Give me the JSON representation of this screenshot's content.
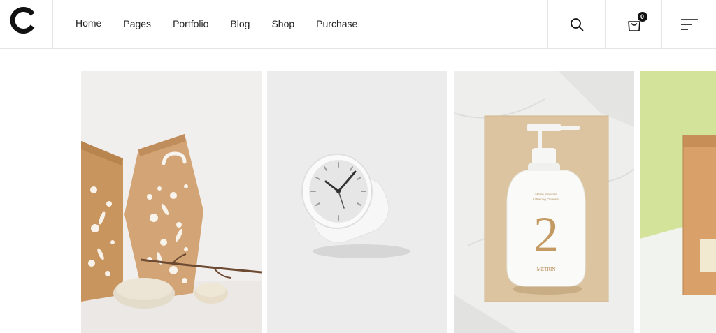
{
  "brand": {
    "logo_icon": "ring-logo-icon"
  },
  "nav": {
    "items": [
      {
        "label": "Home",
        "active": true
      },
      {
        "label": "Pages",
        "active": false
      },
      {
        "label": "Portfolio",
        "active": false
      },
      {
        "label": "Blog",
        "active": false
      },
      {
        "label": "Shop",
        "active": false
      },
      {
        "label": "Purchase",
        "active": false
      }
    ]
  },
  "header_actions": {
    "search_icon": "search-icon",
    "cart_icon": "shopping-bag-icon",
    "cart_count": "0",
    "menu_icon": "hamburger-menu-icon"
  },
  "gallery": {
    "items": [
      {
        "subject": "kraft-paper-bags"
      },
      {
        "subject": "white-desk-clock"
      },
      {
        "subject": "white-soap-bottle",
        "bottle_number": "2",
        "bottle_brand": "METRIN",
        "bottle_small_text_1": "Metrin Skincare",
        "bottle_small_text_2": "Lathering Cleanser"
      },
      {
        "subject": "kraft-pouch"
      }
    ]
  },
  "colors": {
    "accent_dark": "#111111",
    "kraft": "#d3a475",
    "wood": "#dcc4a0",
    "lime": "#d3e49a"
  }
}
